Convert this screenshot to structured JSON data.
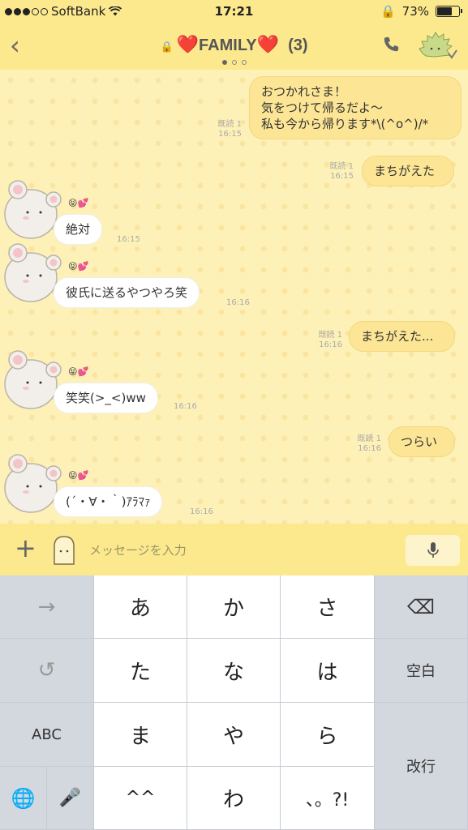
{
  "status": {
    "carrier": "SoftBank",
    "time": "17:21",
    "battery": "73%",
    "battery_fraction": 0.73
  },
  "header": {
    "title": "FAMILY",
    "count": "(3)",
    "heart": "❤️"
  },
  "chat": {
    "messages": [
      {
        "dir": "out",
        "text": "おつかれさま！\n気をつけて帰るだよ〜\n私も今から帰ります*\\(^o^)/*",
        "read": "既読 1",
        "time": "16:15"
      },
      {
        "dir": "out",
        "text": "まちがえた",
        "read": "既読 1",
        "time": "16:15"
      },
      {
        "dir": "in",
        "text": "絶対",
        "time": "16:15",
        "emoji": "😝💕"
      },
      {
        "dir": "in",
        "text": "彼氏に送るやつやろ笑",
        "time": "16:16",
        "emoji": "😝💕"
      },
      {
        "dir": "out",
        "text": "まちがえた...",
        "read": "既読 1",
        "time": "16:16"
      },
      {
        "dir": "in",
        "text": "笑笑(>_<)ww",
        "time": "16:16",
        "emoji": "😝💕"
      },
      {
        "dir": "out",
        "text": "つらい",
        "read": "既読 1",
        "time": "16:16"
      },
      {
        "dir": "in",
        "text": "(´・∀・｀)ｱﾗﾏｧ",
        "time": "16:16",
        "emoji": "😝💕"
      }
    ]
  },
  "input": {
    "placeholder": "メッセージを入力"
  },
  "keyboard": {
    "keys": [
      [
        "→",
        "あ",
        "か",
        "さ",
        "⌫"
      ],
      [
        "↺",
        "た",
        "な",
        "は",
        "空白"
      ],
      [
        "ABC",
        "ま",
        "や",
        "ら",
        "改行"
      ],
      [
        "🌐",
        "🎤",
        "^^",
        "わ",
        "、。?!"
      ]
    ]
  },
  "colors": {
    "header": "#fde98d",
    "bubble_out": "#fce594",
    "bubble_in": "#ffffff",
    "background": "#fdf1b8"
  },
  "icons": [
    "back-chevron-icon",
    "lock-icon",
    "phone-icon",
    "plus-icon",
    "sticker-icon",
    "mic-icon",
    "wifi-icon",
    "globe-icon",
    "delete-icon",
    "undo-icon"
  ]
}
